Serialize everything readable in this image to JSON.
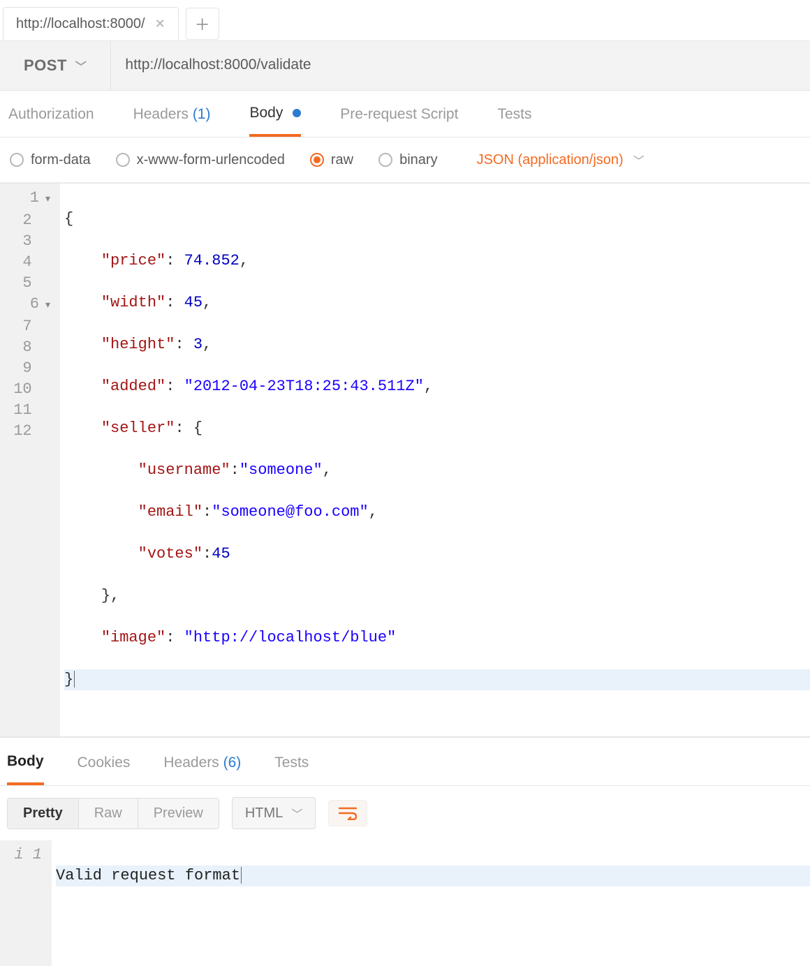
{
  "tabs": {
    "items": [
      {
        "label": "http://localhost:8000/"
      }
    ]
  },
  "request": {
    "method": "POST",
    "url": "http://localhost:8000/validate"
  },
  "section_tabs": {
    "authorization": "Authorization",
    "headers_label": "Headers",
    "headers_count": "(1)",
    "body": "Body",
    "prerequest": "Pre-request Script",
    "tests": "Tests"
  },
  "body_types": {
    "form_data": "form-data",
    "urlencoded": "x-www-form-urlencoded",
    "raw": "raw",
    "binary": "binary",
    "content_type": "JSON (application/json)"
  },
  "editor": {
    "lines": [
      "1",
      "2",
      "3",
      "4",
      "5",
      "6",
      "7",
      "8",
      "9",
      "10",
      "11",
      "12"
    ],
    "body": {
      "price": 74.852,
      "width": 45,
      "height": 3,
      "added": "2012-04-23T18:25:43.511Z",
      "seller": {
        "username": "someone",
        "email": "someone@foo.com",
        "votes": 45
      },
      "image": "http://localhost/blue"
    },
    "tokens": {
      "price_key": "\"price\"",
      "width_key": "\"width\"",
      "height_key": "\"height\"",
      "added_key": "\"added\"",
      "seller_key": "\"seller\"",
      "username_key": "\"username\"",
      "email_key": "\"email\"",
      "votes_key": "\"votes\"",
      "image_key": "\"image\"",
      "price_val": "74.852",
      "width_val": "45",
      "height_val": "3",
      "votes_val": "45",
      "added_val": "\"2012-04-23T18:25:43.511Z\"",
      "username_val": "\"someone\"",
      "email_val": "\"someone@foo.com\"",
      "image_val": "\"http://localhost/blue\""
    }
  },
  "response_tabs": {
    "body": "Body",
    "cookies": "Cookies",
    "headers_label": "Headers",
    "headers_count": "(6)",
    "tests": "Tests"
  },
  "response_toolbar": {
    "pretty": "Pretty",
    "raw": "Raw",
    "preview": "Preview",
    "type": "HTML"
  },
  "response_body": {
    "gutter_prefix": "i",
    "line_no": "1",
    "text": "Valid request format"
  }
}
